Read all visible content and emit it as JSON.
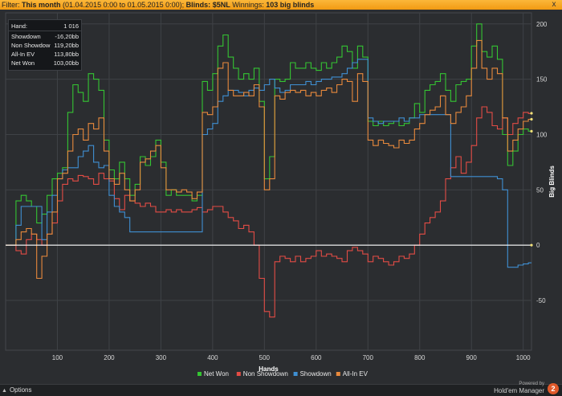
{
  "filter_bar": {
    "filter_label": "Filter:",
    "filter_value": "This month",
    "date_range": "(01.04.2015 0:00 to 01.05.2015 0:00);",
    "blinds_label": "Blinds:",
    "blinds_value": "$5NL",
    "winnings_label": "Winnings:",
    "winnings_value": "103 big blinds",
    "close_symbol": "x"
  },
  "stats_box": {
    "rows": [
      {
        "label": "Hand:",
        "value": "1 016"
      },
      {
        "label": "Showdown",
        "value": "-16,20bb"
      },
      {
        "label": "Non Showdow",
        "value": "119,20bb"
      },
      {
        "label": "All-In EV",
        "value": "113,80bb"
      },
      {
        "label": "Net Won",
        "value": "103,00bb"
      }
    ]
  },
  "bottom_bar": {
    "options_label": "Options",
    "powered_line1": "Powered by",
    "powered_line2": "Hold'em Manager",
    "badge": "2"
  },
  "chart_data": {
    "type": "line",
    "title": "",
    "xlabel": "Hands",
    "ylabel": "Big Blinds",
    "xlim": [
      0,
      1016
    ],
    "ylim": [
      -95,
      210
    ],
    "x_ticks": [
      100,
      200,
      300,
      400,
      500,
      600,
      700,
      800,
      900,
      1000
    ],
    "y_ticks": [
      -50,
      0,
      50,
      100,
      150,
      200
    ],
    "grid": true,
    "legend_position": "bottom-center",
    "zero_line_color": "#ffffff",
    "background": "#2b2d30",
    "series": [
      {
        "name": "Net Won",
        "color": "#34c432",
        "x": [
          0,
          10,
          20,
          30,
          40,
          50,
          60,
          70,
          80,
          90,
          100,
          110,
          120,
          130,
          140,
          150,
          160,
          170,
          180,
          190,
          200,
          210,
          220,
          230,
          240,
          250,
          260,
          270,
          280,
          290,
          300,
          310,
          320,
          330,
          340,
          350,
          360,
          370,
          380,
          390,
          400,
          410,
          420,
          430,
          440,
          450,
          460,
          470,
          480,
          490,
          500,
          510,
          520,
          530,
          540,
          550,
          560,
          570,
          580,
          590,
          600,
          610,
          620,
          630,
          640,
          650,
          660,
          670,
          680,
          690,
          700,
          710,
          720,
          730,
          740,
          750,
          760,
          770,
          780,
          790,
          800,
          810,
          820,
          830,
          840,
          850,
          860,
          870,
          880,
          890,
          900,
          910,
          920,
          930,
          940,
          950,
          960,
          970,
          980,
          990,
          1000,
          1010,
          1016
        ],
        "y": [
          0,
          0,
          40,
          45,
          40,
          35,
          20,
          28,
          45,
          60,
          65,
          70,
          120,
          145,
          138,
          130,
          155,
          150,
          140,
          95,
          68,
          60,
          75,
          60,
          45,
          55,
          80,
          72,
          80,
          95,
          75,
          45,
          50,
          45,
          45,
          45,
          40,
          45,
          148,
          140,
          155,
          180,
          190,
          170,
          160,
          150,
          155,
          150,
          160,
          130,
          60,
          80,
          150,
          148,
          150,
          165,
          160,
          160,
          165,
          160,
          158,
          165,
          160,
          165,
          170,
          180,
          175,
          160,
          180,
          170,
          112,
          108,
          112,
          108,
          110,
          112,
          108,
          110,
          115,
          128,
          120,
          140,
          145,
          148,
          155,
          140,
          130,
          145,
          148,
          150,
          180,
          200,
          175,
          170,
          180,
          168,
          100,
          72,
          85,
          100,
          105,
          103,
          103
        ]
      },
      {
        "name": "Non Showdown",
        "color": "#e34c45",
        "x": [
          0,
          10,
          20,
          30,
          40,
          50,
          60,
          70,
          80,
          90,
          100,
          110,
          120,
          130,
          140,
          150,
          160,
          170,
          180,
          190,
          200,
          210,
          220,
          230,
          240,
          250,
          260,
          270,
          280,
          290,
          300,
          310,
          320,
          330,
          340,
          350,
          360,
          370,
          380,
          390,
          400,
          410,
          420,
          430,
          440,
          450,
          460,
          470,
          480,
          490,
          500,
          510,
          520,
          530,
          540,
          550,
          560,
          570,
          580,
          590,
          600,
          610,
          620,
          630,
          640,
          650,
          660,
          670,
          680,
          690,
          700,
          710,
          720,
          730,
          740,
          750,
          760,
          770,
          780,
          790,
          800,
          810,
          820,
          830,
          840,
          850,
          860,
          870,
          880,
          890,
          900,
          910,
          920,
          930,
          940,
          950,
          960,
          970,
          980,
          990,
          1000,
          1010,
          1016
        ],
        "y": [
          0,
          0,
          -5,
          -8,
          5,
          10,
          5,
          0,
          10,
          20,
          40,
          55,
          60,
          58,
          63,
          62,
          60,
          55,
          65,
          60,
          58,
          42,
          32,
          45,
          40,
          38,
          35,
          38,
          35,
          30,
          30,
          32,
          30,
          32,
          30,
          30,
          32,
          34,
          30,
          32,
          35,
          35,
          30,
          25,
          22,
          15,
          18,
          12,
          0,
          -30,
          -60,
          -65,
          -15,
          -10,
          -12,
          -15,
          -10,
          -15,
          -12,
          -10,
          -5,
          -10,
          -8,
          -10,
          -12,
          -15,
          -5,
          -2,
          -5,
          -8,
          -15,
          -10,
          -12,
          -15,
          -18,
          -15,
          -10,
          -12,
          -8,
          0,
          10,
          20,
          25,
          30,
          40,
          60,
          70,
          80,
          65,
          75,
          90,
          115,
          125,
          120,
          108,
          105,
          115,
          100,
          110,
          115,
          120,
          119,
          119
        ]
      },
      {
        "name": "Showdown",
        "color": "#3f8fd2",
        "x": [
          0,
          10,
          20,
          30,
          40,
          50,
          60,
          70,
          80,
          90,
          100,
          110,
          120,
          130,
          140,
          150,
          160,
          170,
          180,
          190,
          200,
          210,
          220,
          230,
          240,
          250,
          260,
          270,
          280,
          290,
          300,
          310,
          320,
          330,
          340,
          350,
          360,
          370,
          380,
          390,
          400,
          410,
          420,
          430,
          440,
          450,
          460,
          470,
          480,
          490,
          500,
          510,
          520,
          530,
          540,
          550,
          560,
          570,
          580,
          590,
          600,
          610,
          620,
          630,
          640,
          650,
          660,
          670,
          680,
          690,
          700,
          710,
          720,
          730,
          740,
          750,
          760,
          770,
          780,
          790,
          800,
          810,
          820,
          830,
          840,
          850,
          860,
          870,
          880,
          890,
          900,
          910,
          920,
          930,
          940,
          950,
          960,
          970,
          980,
          990,
          1000,
          1010,
          1016
        ],
        "y": [
          0,
          0,
          18,
          35,
          35,
          35,
          35,
          5,
          30,
          45,
          60,
          68,
          70,
          70,
          80,
          85,
          90,
          75,
          70,
          72,
          45,
          35,
          30,
          25,
          12,
          12,
          12,
          12,
          12,
          12,
          12,
          12,
          12,
          12,
          12,
          12,
          12,
          12,
          100,
          105,
          110,
          130,
          135,
          140,
          140,
          138,
          135,
          140,
          142,
          140,
          145,
          150,
          142,
          138,
          140,
          145,
          145,
          145,
          148,
          145,
          148,
          150,
          150,
          152,
          152,
          155,
          160,
          165,
          168,
          168,
          115,
          112,
          110,
          112,
          112,
          112,
          115,
          112,
          115,
          115,
          118,
          118,
          118,
          118,
          118,
          118,
          62,
          62,
          62,
          62,
          62,
          62,
          62,
          62,
          62,
          60,
          50,
          -20,
          -20,
          -18,
          -17,
          -16,
          -16
        ]
      },
      {
        "name": "All-In EV",
        "color": "#e8893c",
        "x": [
          0,
          10,
          20,
          30,
          40,
          50,
          60,
          70,
          80,
          90,
          100,
          110,
          120,
          130,
          140,
          150,
          160,
          170,
          180,
          190,
          200,
          210,
          220,
          230,
          240,
          250,
          260,
          270,
          280,
          290,
          300,
          310,
          320,
          330,
          340,
          350,
          360,
          370,
          380,
          390,
          400,
          410,
          420,
          430,
          440,
          450,
          460,
          470,
          480,
          490,
          500,
          510,
          520,
          530,
          540,
          550,
          560,
          570,
          580,
          590,
          600,
          610,
          620,
          630,
          640,
          650,
          660,
          670,
          680,
          690,
          700,
          710,
          720,
          730,
          740,
          750,
          760,
          770,
          780,
          790,
          800,
          810,
          820,
          830,
          840,
          850,
          860,
          870,
          880,
          890,
          900,
          910,
          920,
          930,
          940,
          950,
          960,
          970,
          980,
          990,
          1000,
          1010,
          1016
        ],
        "y": [
          0,
          0,
          5,
          12,
          15,
          10,
          -30,
          -10,
          10,
          30,
          60,
          65,
          85,
          100,
          105,
          95,
          110,
          105,
          115,
          85,
          60,
          55,
          65,
          50,
          40,
          50,
          75,
          78,
          85,
          90,
          70,
          50,
          50,
          48,
          50,
          48,
          42,
          48,
          120,
          118,
          125,
          160,
          165,
          140,
          135,
          135,
          138,
          135,
          145,
          125,
          50,
          60,
          135,
          132,
          138,
          140,
          138,
          140,
          135,
          138,
          135,
          140,
          142,
          138,
          145,
          150,
          148,
          130,
          155,
          148,
          95,
          90,
          95,
          92,
          90,
          88,
          95,
          92,
          95,
          105,
          110,
          118,
          122,
          125,
          135,
          118,
          110,
          120,
          125,
          135,
          160,
          185,
          160,
          150,
          160,
          155,
          115,
          85,
          95,
          105,
          112,
          113.8,
          113.8
        ]
      }
    ],
    "end_markers": [
      113.8,
      119.2,
      103
    ]
  }
}
